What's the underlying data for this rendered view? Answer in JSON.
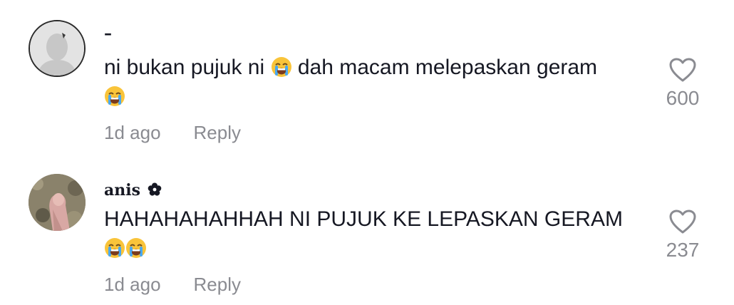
{
  "comments": [
    {
      "username": "–",
      "username_suffix_icon": "",
      "avatar": "default-user-silhouette",
      "text_parts": [
        "ni bukan pujuk ni ",
        "loudly-crying-face-emoji",
        " dah macam melepaskan geram ",
        "loudly-crying-face-emoji"
      ],
      "time": "1d ago",
      "reply_label": "Reply",
      "likes": "600",
      "like_icon": "heart-outline-icon"
    },
    {
      "username": "anis",
      "username_suffix_icon": "flower-icon",
      "avatar": "user-photo",
      "text_parts": [
        "HAHAHAHAHHAH NI PUJUK KE LEPASKAN GERAM ",
        "loudly-crying-face-emoji",
        "loudly-crying-face-emoji"
      ],
      "time": "1d ago",
      "reply_label": "Reply",
      "likes": "237",
      "like_icon": "heart-outline-icon"
    }
  ],
  "colors": {
    "text_primary": "#161823",
    "text_secondary": "#8a8b91",
    "background": "#ffffff"
  }
}
